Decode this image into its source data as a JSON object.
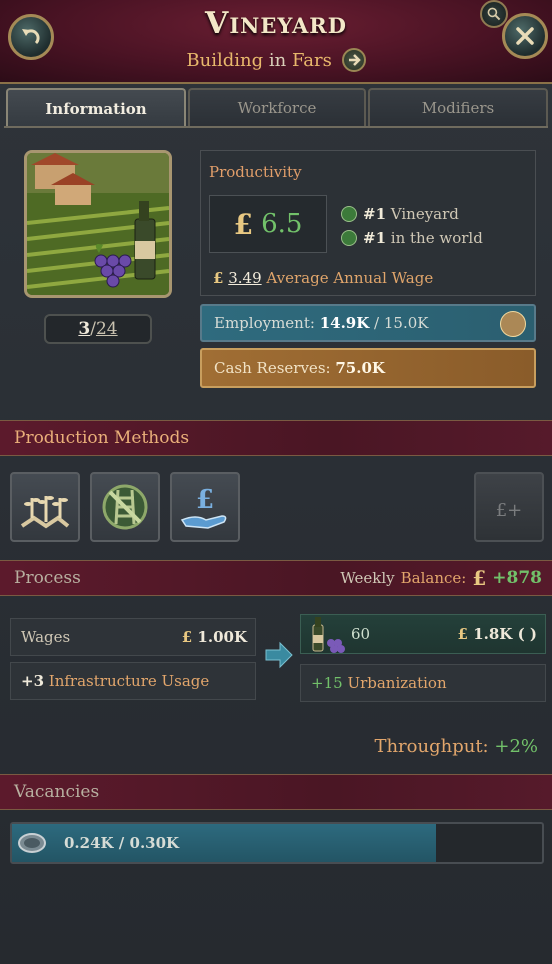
{
  "header": {
    "title": "Vineyard",
    "subtitle_type": "Building",
    "subtitle_in": "in",
    "subtitle_location": "Fars"
  },
  "tabs": [
    {
      "label": "Information",
      "active": true
    },
    {
      "label": "Workforce",
      "active": false
    },
    {
      "label": "Modifiers",
      "active": false
    }
  ],
  "level": {
    "current": "3",
    "separator": "/",
    "max": "24"
  },
  "productivity": {
    "label": "Productivity",
    "currency_symbol": "£",
    "value": "6.5",
    "ranks": [
      {
        "rank": "#1",
        "text": "Vineyard"
      },
      {
        "rank": "#1",
        "text": "in the world"
      }
    ],
    "wage_value": "3.49",
    "wage_label": "Average Annual Wage"
  },
  "employment": {
    "label": "Employment:",
    "current": "14.9K",
    "separator": " / ",
    "max": "15.0K"
  },
  "cash_reserves": {
    "label": "Cash Reserves:",
    "value": "75.0K"
  },
  "production_methods": {
    "title": "Production Methods",
    "methods": [
      "farming-icon",
      "no-railways-icon",
      "wage-subsidy-icon",
      "add-funds-icon"
    ]
  },
  "process": {
    "title": "Process",
    "balance_prefix": "Weekly",
    "balance_label": "Balance:",
    "balance_symbol": "£",
    "balance_value": "+878",
    "wages_label": "Wages",
    "wages_symbol": "£",
    "wages_value": "1.00K",
    "infra_value": "+3",
    "infra_label": "Infrastructure Usage",
    "output_amount": "60",
    "output_symbol": "£",
    "output_value": "1.8K",
    "output_suffix": "( )",
    "urban_value": "+15",
    "urban_label": "Urbanization"
  },
  "throughput": {
    "label": "Throughput:",
    "value": "+2%"
  },
  "vacancies": {
    "title": "Vacancies",
    "current": "0.24K",
    "separator": " / ",
    "max": "0.30K",
    "fill_fraction": 0.8
  },
  "colors": {
    "accent": "#e2a66c",
    "positive": "#72c16a",
    "header": "#4a1324",
    "employment": "#2f6b7e",
    "cash": "#a06e34"
  }
}
